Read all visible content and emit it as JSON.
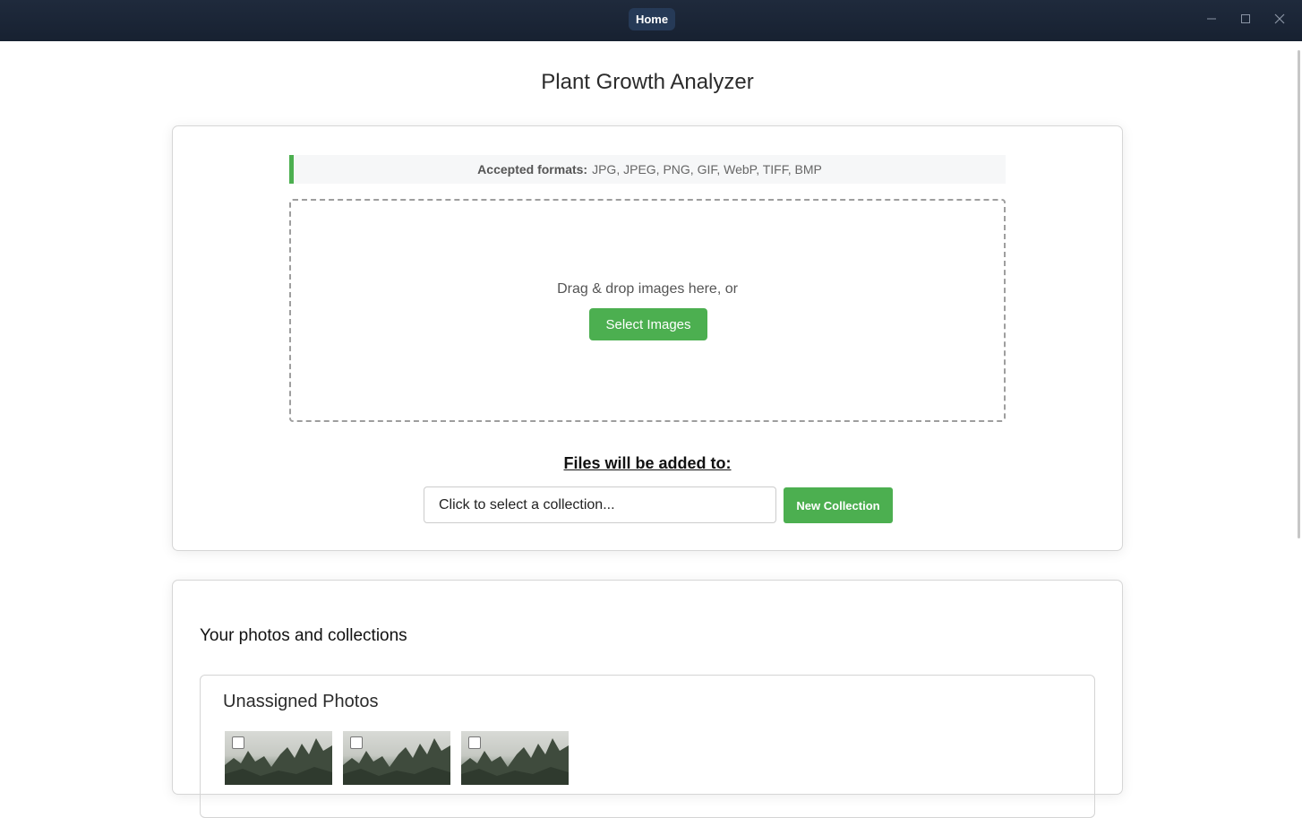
{
  "titlebar": {
    "tab_label": "Home"
  },
  "page": {
    "title": "Plant Growth Analyzer"
  },
  "upload": {
    "formats_label": "Accepted formats:",
    "formats_value": "JPG, JPEG, PNG, GIF, WebP, TIFF, BMP",
    "drop_text": "Drag & drop images here, or",
    "select_button": "Select Images",
    "added_to_label": "Files will be added to:",
    "collection_placeholder": "Click to select a collection...",
    "new_collection_button": "New Collection"
  },
  "photos": {
    "heading": "Your photos and collections",
    "unassigned_title": "Unassigned Photos"
  },
  "colors": {
    "accent": "#4caf50",
    "titlebar": "#1b2535"
  }
}
